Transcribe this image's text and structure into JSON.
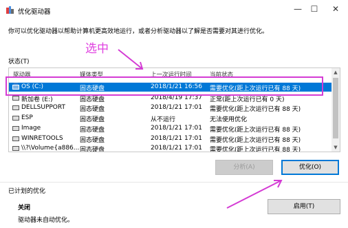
{
  "window": {
    "title": "优化驱动器",
    "minimize": "—",
    "maximize": "☐",
    "close": "✕"
  },
  "description": "你可以优化驱动器以帮助计算机更高效地运行，或者分析驱动器以了解是否需要对其进行优化。",
  "status_label": "状态(T)",
  "table": {
    "headers": [
      "驱动器",
      "媒体类型",
      "上一次运行时间",
      "当前状态"
    ],
    "rows": [
      {
        "drive": "OS (C:)",
        "media": "固态硬盘",
        "last_run": "2018/1/21 16:56",
        "status": "需要优化(距上次运行已有 88 天)"
      },
      {
        "drive": "新加卷 (E:)",
        "media": "固态硬盘",
        "last_run": "2018/4/19 17:37",
        "status": "正常(距上次运行已有 0 天)"
      },
      {
        "drive": "DELLSUPPORT",
        "media": "固态硬盘",
        "last_run": "2018/1/21 17:01",
        "status": "需要优化(距上次运行已有 88 天)"
      },
      {
        "drive": "ESP",
        "media": "固态硬盘",
        "last_run": "从不运行",
        "status": "无法使用优化"
      },
      {
        "drive": "Image",
        "media": "固态硬盘",
        "last_run": "2018/1/21 17:01",
        "status": "需要优化(距上次运行已有 88 天)"
      },
      {
        "drive": "WINRETOOLS",
        "media": "固态硬盘",
        "last_run": "2018/1/21 17:01",
        "status": "需要优化(距上次运行已有 88 天)"
      },
      {
        "drive": "\\\\?\\Volume{a886...",
        "media": "固态硬盘",
        "last_run": "2018/1/21 17:01",
        "status": "需要优化(距上次运行已有 88 天)"
      }
    ]
  },
  "buttons": {
    "analyze": "分析(A)",
    "optimize": "优化(O)",
    "enable": "启用(T)"
  },
  "scheduled": {
    "label": "已计划的优化",
    "state": "关闭",
    "desc": "驱动器未自动优化。"
  },
  "annotation": {
    "text": "选中",
    "color": "#d43bd4"
  }
}
